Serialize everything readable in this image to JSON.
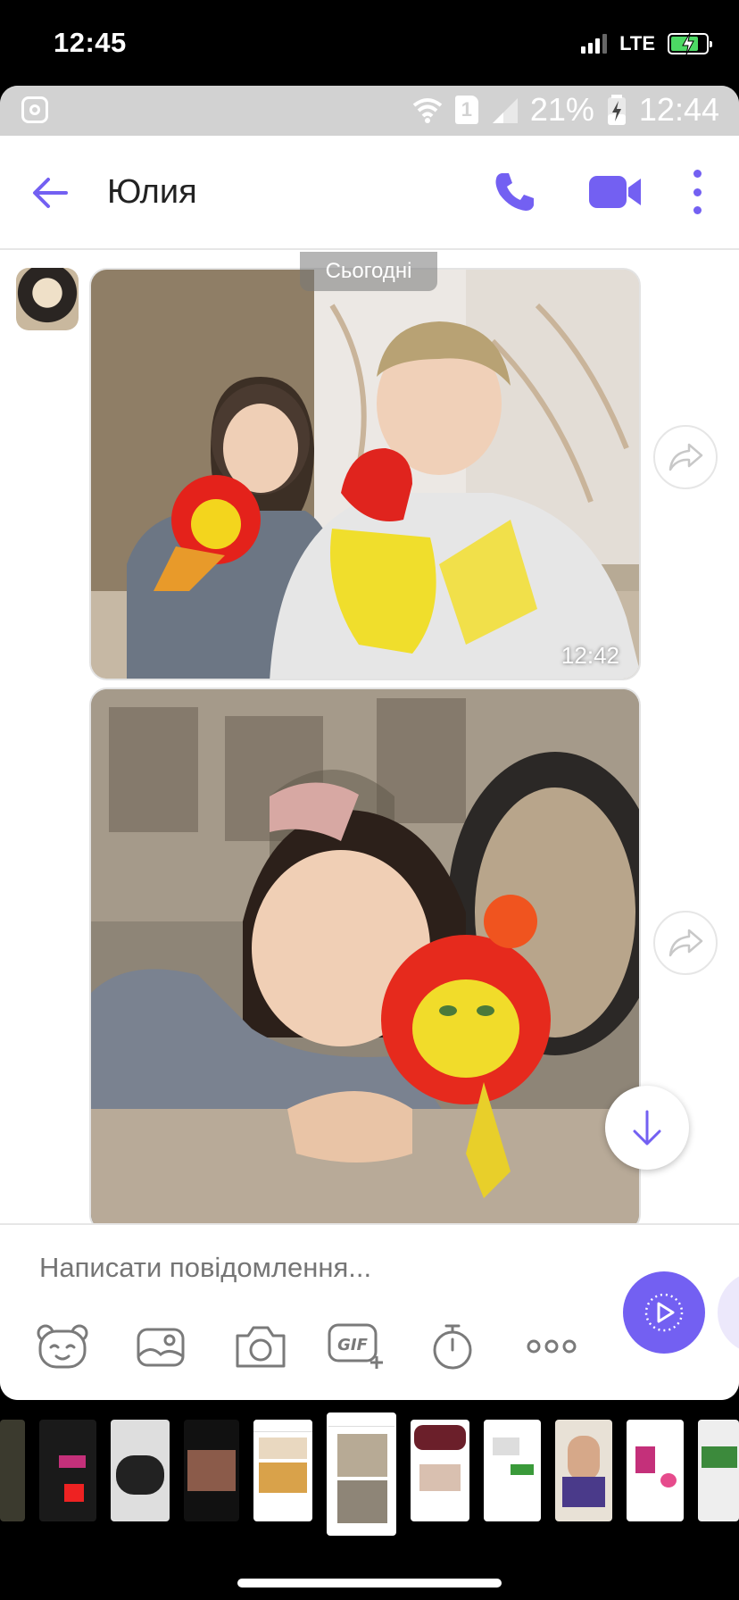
{
  "ios_status": {
    "time": "12:45",
    "network": "LTE"
  },
  "android_status": {
    "battery": "21%",
    "sim": "1",
    "time": "12:44"
  },
  "header": {
    "contact_name": "Юлия"
  },
  "chat": {
    "date_chip": "Сьогодні",
    "messages": [
      {
        "type": "photo",
        "time": "12:42"
      },
      {
        "type": "photo",
        "time": ""
      }
    ]
  },
  "composer": {
    "placeholder": "Написати повідомлення...",
    "tools": [
      "sticker-icon",
      "gallery-icon",
      "camera-icon",
      "gif-icon",
      "timer-icon",
      "more-icon"
    ]
  },
  "colors": {
    "accent": "#7360f2"
  }
}
